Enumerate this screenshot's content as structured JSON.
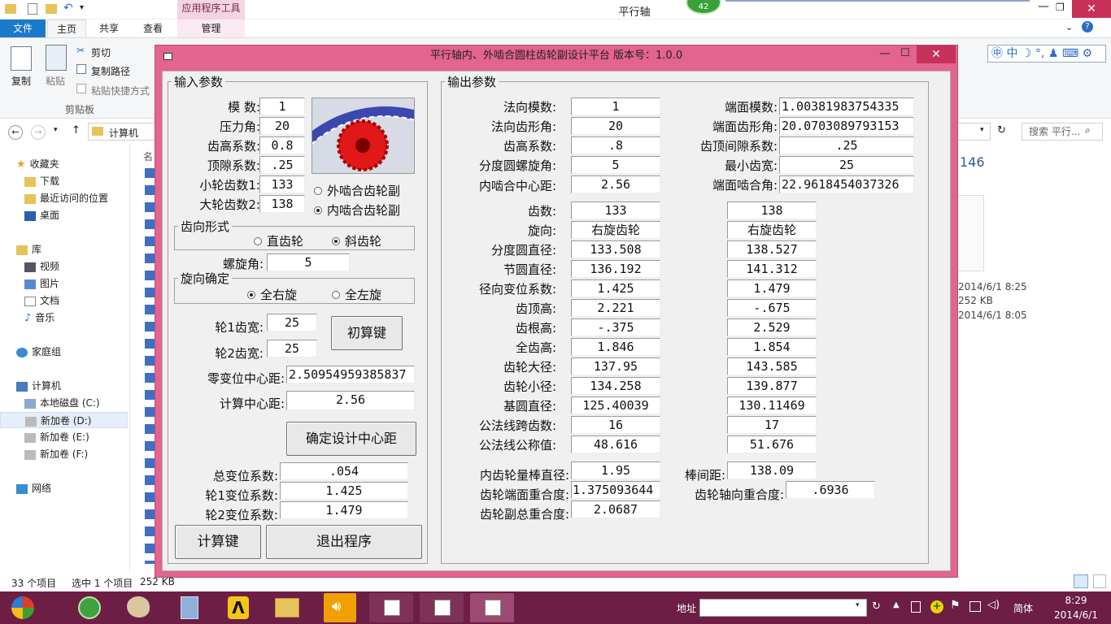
{
  "explorer": {
    "window_title": "平行轴",
    "tabs": {
      "file": "文件",
      "home": "主页",
      "share": "共享",
      "view": "查看",
      "manage": "管理",
      "app_tools": "应用程序工具"
    },
    "ribbon": {
      "copy": "复制",
      "paste": "粘贴",
      "cut": "剪切",
      "copy_path": "复制路径",
      "paste_shortcut": "粘贴快捷方式",
      "clipboard": "剪贴板"
    },
    "address": {
      "path": "计算机",
      "search_placeholder": "搜索 平行..."
    },
    "nav": {
      "favorites": "收藏夹",
      "downloads": "下载",
      "recent": "最近访问的位置",
      "desktop": "桌面",
      "libraries": "库",
      "videos": "视频",
      "pictures": "图片",
      "documents": "文档",
      "music": "音乐",
      "homegroup": "家庭组",
      "computer": "计算机",
      "drive_c": "本地磁盘 (C:)",
      "drive_d": "新加卷 (D:)",
      "drive_e": "新加卷 (E:)",
      "drive_f": "新加卷 (F:)",
      "network": "网络"
    },
    "column_header": "名",
    "right_pane": {
      "frag": "146",
      "date1": "2014/6/1 8:25",
      "size": "252 KB",
      "date2": "2014/6/1 8:05"
    },
    "status": {
      "count": "33 个项目",
      "selected": "选中 1 个项目",
      "size": "252 KB"
    },
    "badge": "42"
  },
  "app": {
    "title": "平行轴内、外啮合圆柱齿轮副设计平台 版本号：1.0.0",
    "input_legend": "输入参数",
    "output_legend": "输出参数",
    "inputs": {
      "module_label": "模  数:",
      "module": "1",
      "pressure_label": "压力角:",
      "pressure": "20",
      "addendum_label": "齿高系数:",
      "addendum": "0.8",
      "clearance_label": "顶隙系数:",
      "clearance": ".25",
      "z1_label": "小轮齿数1:",
      "z1": "133",
      "z2_label": "大轮齿数2:",
      "z2": "138",
      "mesh_external": "外啮合齿轮副",
      "mesh_internal": "内啮合齿轮副",
      "tooth_form_legend": "齿向形式",
      "spur": "直齿轮",
      "helical": "斜齿轮",
      "helix_label": "螺旋角:",
      "helix": "5",
      "hand_legend": "旋向确定",
      "all_right": "全右旋",
      "all_left": "全左旋",
      "b1_label": "轮1齿宽:",
      "b1": "25",
      "b2_label": "轮2齿宽:",
      "b2": "25",
      "init_button": "初算键",
      "zero_center_label": "零变位中心距:",
      "zero_center": "2.50954959385837",
      "calc_center_label": "计算中心距:",
      "calc_center": "2.56",
      "confirm_button": "确定设计中心距",
      "total_shift_label": "总变位系数:",
      "total_shift": ".054",
      "shift1_label": "轮1变位系数:",
      "shift1": "1.425",
      "shift2_label": "轮2变位系数:",
      "shift2": "1.479",
      "calc_button": "计算键",
      "exit_button": "退出程序"
    },
    "outputs": {
      "normal_module_label": "法向模数:",
      "normal_module": "1",
      "normal_pressure_label": "法向齿形角:",
      "normal_pressure": "20",
      "addendum_coef_label": "齿高系数:",
      "addendum_coef": ".8",
      "helix_label": "分度圆螺旋角:",
      "helix": "5",
      "center_label": "内啮合中心距:",
      "center": "2.56",
      "transverse_module_label": "端面模数:",
      "transverse_module": "1.00381983754335",
      "transverse_pressure_label": "端面齿形角:",
      "transverse_pressure": "20.0703089793153",
      "tip_clearance_label": "齿顶间隙系数:",
      "tip_clearance": ".25",
      "min_width_label": "最小齿宽:",
      "min_width": "25",
      "working_angle_label": "端面啮合角:",
      "working_angle": "22.9618454037326",
      "rows": [
        {
          "label": "齿数:",
          "g1": "133",
          "g2": "138"
        },
        {
          "label": "旋向:",
          "g1": "右旋齿轮",
          "g2": "右旋齿轮"
        },
        {
          "label": "分度圆直径:",
          "g1": "133.508",
          "g2": "138.527"
        },
        {
          "label": "节圆直径:",
          "g1": "136.192",
          "g2": "141.312"
        },
        {
          "label": "径向变位系数:",
          "g1": "1.425",
          "g2": "1.479"
        },
        {
          "label": "齿顶高:",
          "g1": "2.221",
          "g2": "-.675"
        },
        {
          "label": "齿根高:",
          "g1": "-.375",
          "g2": "2.529"
        },
        {
          "label": "全齿高:",
          "g1": "1.846",
          "g2": "1.854"
        },
        {
          "label": "齿轮大径:",
          "g1": "137.95",
          "g2": "143.585"
        },
        {
          "label": "齿轮小径:",
          "g1": "134.258",
          "g2": "139.877"
        },
        {
          "label": "基圆直径:",
          "g1": "125.40039",
          "g2": "130.11469"
        },
        {
          "label": "公法线跨齿数:",
          "g1": "16",
          "g2": "17"
        },
        {
          "label": "公法线公称值:",
          "g1": "48.616",
          "g2": "51.676"
        }
      ],
      "pin_dia_label": "内齿轮量棒直径:",
      "pin_dia": "1.95",
      "pin_dist_label": "棒间距:",
      "pin_dist": "138.09",
      "transverse_ratio_label": "齿轮端面重合度:",
      "transverse_ratio": "1.375093644",
      "axial_ratio_label": "齿轮轴向重合度:",
      "axial_ratio": ".6936",
      "total_ratio_label": "齿轮副总重合度:",
      "total_ratio": "2.0687"
    }
  },
  "taskbar": {
    "address_label": "地址",
    "ime": "简体",
    "time": "8:29",
    "date": "2014/6/1"
  },
  "colors": {
    "window_frame": "#e2648f",
    "taskbar": "#6c1e45",
    "ribbon_file_tab": "#1979ca",
    "gear_red": "#e01818",
    "gear_blue": "#3c48b0"
  }
}
